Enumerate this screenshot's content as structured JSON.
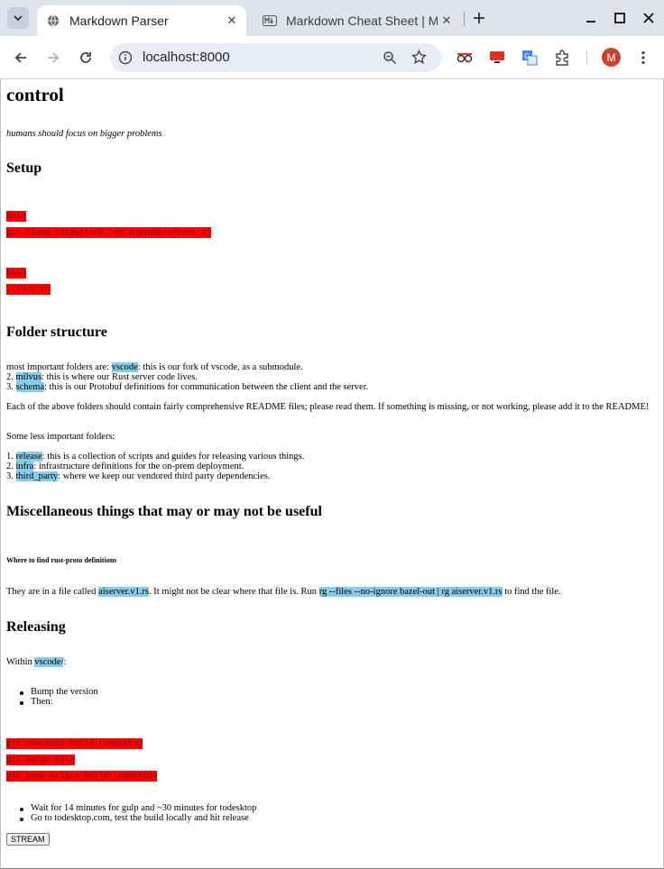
{
  "browser": {
    "tabs": [
      {
        "title": "Markdown Parser",
        "active": true
      },
      {
        "title": "Markdown Cheat Sheet | M",
        "active": false
      }
    ],
    "url": "localhost:8000"
  },
  "page": {
    "title": "control",
    "tagline": "humans should focus on bigger problems",
    "setup": {
      "heading": "Setup",
      "block1": [
        "bash",
        "git clone git@github.com:anysphere/control"
      ],
      "block2": [
        "bash",
        "./init.sh"
      ]
    },
    "folders": {
      "heading": "Folder structure",
      "lines": [
        {
          "pre": "most important folders are: ",
          "code": "vscode",
          "post": ": this is our fork of vscode, as a submodule."
        },
        {
          "pre": "2. ",
          "code": "milvus",
          "post": ": this is where our Rust server code lives."
        },
        {
          "pre": "3. ",
          "code": "schema",
          "post": ": this is our Protobuf definitions for communication between the client and the server."
        }
      ],
      "readme_note": "Each of the above folders should contain fairly comprehensive README files; please read them. If something is missing, or not working, please add it to the README!",
      "less_intro": "Some less important folders:",
      "less_lines": [
        {
          "pre": "1. ",
          "code": "release",
          "post": ": this is a collection of scripts and guides for releasing various things."
        },
        {
          "pre": "2. ",
          "code": "infra",
          "post": ": infrastructure definitions for the on-prem deployment."
        },
        {
          "pre": "3. ",
          "code": "third_party",
          "post": ": where we keep our vendored third party dependencies."
        }
      ]
    },
    "misc": {
      "heading": "Miscellaneous things that may or may not be useful",
      "subheading": "Where to find rust-proto definitions",
      "p_pre": "They are in a file called ",
      "p_code1": "aiserver.v1.rs",
      "p_mid": ". It might not be clear where that file is. Run ",
      "p_code2": "rg --files --no-ignore bazel-out | rg aiserver.v1.rs",
      "p_post": " to find the file."
    },
    "releasing": {
      "heading": "Releasing",
      "within_pre": "Within ",
      "within_code": "vscode/",
      "within_post": ":",
      "bullets1": [
        "Bump the version",
        "Then:"
      ],
      "block": [
        "git checkout build-todesktop",
        "git merge main",
        "git push origin build-todesktop"
      ],
      "bullets2": [
        "Wait for 14 minutes for gulp and ~30 minutes for todesktop",
        "Go to todesktop.com, test the build locally and hit release"
      ]
    },
    "stream_button": "STREAM"
  },
  "colors": {
    "code_block_bg": "#ff0000",
    "inline_code_bg": "#87cdea",
    "avatar": "#c5432f"
  },
  "icons": [
    "tab-search-icon",
    "globe-icon",
    "markdown-icon",
    "close-icon",
    "new-tab-icon",
    "minimize-icon",
    "maximize-icon",
    "window-close-icon",
    "back-icon",
    "forward-icon",
    "reload-icon",
    "site-info-icon",
    "zoom-icon",
    "bookmark-star-icon",
    "extension-icon",
    "menu-icon"
  ],
  "profile_initial": "M"
}
